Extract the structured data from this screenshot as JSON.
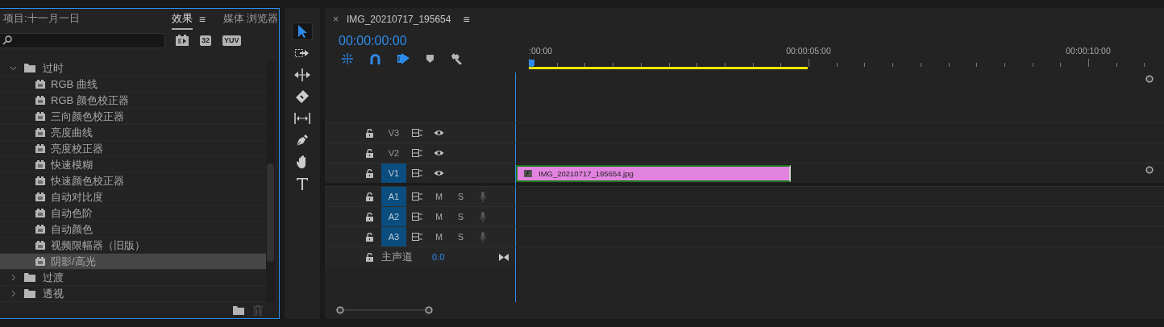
{
  "effects_panel": {
    "tabs": [
      {
        "label": "项目:十一月一日",
        "selected": false
      },
      {
        "label": "效果",
        "selected": true,
        "menu": "≡"
      },
      {
        "label": "媒体 浏览器",
        "selected": false
      }
    ],
    "filters": [
      {
        "kind": "accelerated"
      },
      {
        "kind": "bits",
        "label": "32"
      },
      {
        "kind": "yuv",
        "label": "YUV"
      }
    ],
    "tree": [
      {
        "kind": "folder",
        "label": "过时",
        "expanded": true,
        "selected": false,
        "children": [
          {
            "kind": "effect",
            "label": "RGB 曲线",
            "selected": false
          },
          {
            "kind": "effect",
            "label": "RGB 颜色校正器",
            "selected": false
          },
          {
            "kind": "effect",
            "label": "三向颜色校正器",
            "selected": false
          },
          {
            "kind": "effect",
            "label": "亮度曲线",
            "selected": false
          },
          {
            "kind": "effect",
            "label": "亮度校正器",
            "selected": false
          },
          {
            "kind": "effect",
            "label": "快速模糊",
            "selected": false
          },
          {
            "kind": "effect",
            "label": "快速颜色校正器",
            "selected": false
          },
          {
            "kind": "effect",
            "label": "自动对比度",
            "selected": false
          },
          {
            "kind": "effect",
            "label": "自动色阶",
            "selected": false
          },
          {
            "kind": "effect",
            "label": "自动颜色",
            "selected": false
          },
          {
            "kind": "effect",
            "label": "视频限幅器（旧版）",
            "selected": false
          },
          {
            "kind": "effect",
            "label": "阴影/高光",
            "selected": true
          }
        ]
      },
      {
        "kind": "folder",
        "label": "过渡",
        "expanded": false,
        "selected": false
      },
      {
        "kind": "folder",
        "label": "透视",
        "expanded": false,
        "selected": false
      }
    ]
  },
  "tools": [
    {
      "kind": "select",
      "selected": true
    },
    {
      "kind": "track-select",
      "selected": false
    },
    {
      "kind": "ripple",
      "selected": false
    },
    {
      "kind": "razor",
      "selected": false
    },
    {
      "kind": "slip",
      "selected": false
    },
    {
      "kind": "pen",
      "selected": false
    },
    {
      "kind": "hand",
      "selected": false
    },
    {
      "kind": "type",
      "selected": false
    }
  ],
  "timeline": {
    "tab": {
      "close": "×",
      "title": "IMG_20210717_195654",
      "menu": "≡"
    },
    "timecode": "00:00:00:00",
    "toolbar": [
      {
        "kind": "nest",
        "on": true
      },
      {
        "kind": "snap",
        "on": true
      },
      {
        "kind": "linked",
        "on": true
      },
      {
        "kind": "marker",
        "on": false
      },
      {
        "kind": "settings",
        "on": false
      }
    ],
    "ruler": [
      ":00:00",
      "00:00:05:00",
      "00:00:10:00"
    ],
    "tracks": [
      {
        "kind": "video",
        "name": "V3",
        "targeted": false
      },
      {
        "kind": "video",
        "name": "V2",
        "targeted": false
      },
      {
        "kind": "video",
        "name": "V1",
        "targeted": true,
        "clips": [
          {
            "label": "IMG_20210717_195654.jpg"
          }
        ]
      },
      {
        "kind": "audio",
        "name": "A1",
        "targeted": true,
        "mute": "M",
        "solo": "S"
      },
      {
        "kind": "audio",
        "name": "A2",
        "targeted": true,
        "mute": "M",
        "solo": "S"
      },
      {
        "kind": "audio",
        "name": "A3",
        "targeted": true,
        "mute": "M",
        "solo": "S"
      },
      {
        "kind": "master",
        "name": "主声道",
        "value": "0.0"
      }
    ]
  }
}
